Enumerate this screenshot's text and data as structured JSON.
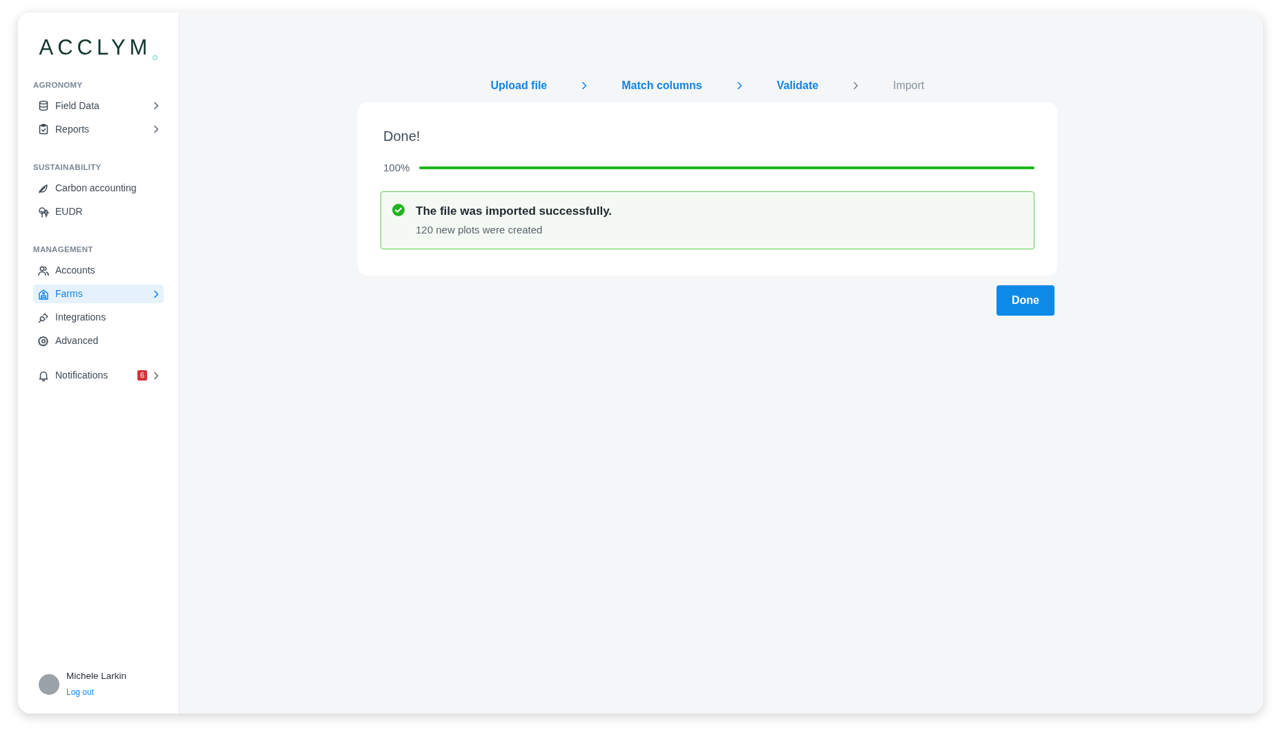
{
  "logo": {
    "text": "ACCLYM"
  },
  "sidebar": {
    "sections": [
      {
        "heading": "AGRONOMY",
        "items": [
          {
            "label": "Field Data",
            "arrow": true,
            "selected": false
          },
          {
            "label": "Reports",
            "arrow": true,
            "selected": false
          }
        ]
      },
      {
        "heading": "SUSTAINABILITY",
        "items": [
          {
            "label": "Carbon accounting",
            "arrow": false,
            "selected": false
          },
          {
            "label": "EUDR",
            "arrow": false,
            "selected": false
          }
        ]
      },
      {
        "heading": "MANAGEMENT",
        "items": [
          {
            "label": "Accounts",
            "arrow": false,
            "selected": false
          },
          {
            "label": "Farms",
            "arrow": true,
            "selected": true
          },
          {
            "label": "Integrations",
            "arrow": false,
            "selected": false
          },
          {
            "label": "Advanced",
            "arrow": false,
            "selected": false
          }
        ]
      }
    ],
    "notifications": {
      "label": "Notifications",
      "badge": "6",
      "arrow": true,
      "selected": false
    },
    "user": {
      "name": "Michele Larkin",
      "action": "Log out"
    }
  },
  "stepper": {
    "steps": [
      {
        "label": "Upload file",
        "completed": true
      },
      {
        "label": "Match columns",
        "completed": true
      },
      {
        "label": "Validate",
        "completed": true
      },
      {
        "label": "Import",
        "completed": false
      }
    ]
  },
  "card": {
    "title": "Done!",
    "progress": {
      "reading": "100%",
      "level": 1
    },
    "alert": {
      "title": "The file was imported successfully.",
      "text": "120 new plots were created"
    }
  },
  "button": {
    "label": "Done"
  }
}
